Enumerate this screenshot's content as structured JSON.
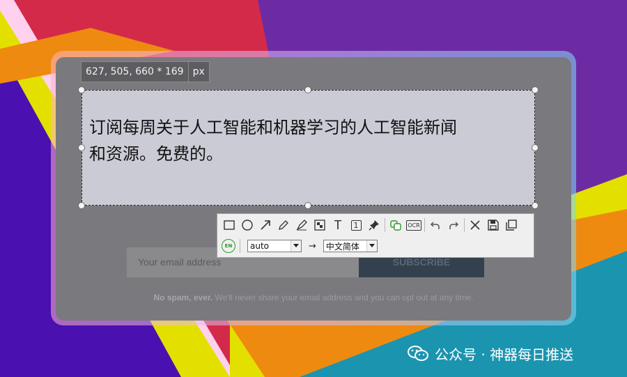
{
  "background": {
    "colors": {
      "red": "#d42a4a",
      "purple": "#6c2ba3",
      "yellow": "#e3e000",
      "orange": "#ee8a10",
      "blue": "#4a10b0",
      "teal": "#1b94b0",
      "pink": "#ffd1ee"
    }
  },
  "page": {
    "email_placeholder": "Your email address",
    "subscribe_label": "SUBSCRIBE",
    "nospam_bold": "No spam, ever.",
    "nospam_text": " We'll never share your email address and you can opt out at any time."
  },
  "capture": {
    "dimensions": "627, 505, 660 * 169",
    "unit": "px",
    "selected_text_line1": "订阅每周关于人工智能和机器学习的人工智能新闻",
    "selected_text_line2": "和资源。免费的。"
  },
  "toolbar": {
    "tools": [
      "rectangle-icon",
      "ellipse-icon",
      "arrow-icon",
      "pen-icon",
      "marker-icon",
      "mosaic-icon",
      "text-icon",
      "number-icon",
      "pin-icon",
      "translate-icon",
      "ocr-icon",
      "undo-icon",
      "redo-icon",
      "close-icon",
      "save-icon",
      "copy-icon"
    ],
    "ocr_label": "OCR",
    "number_label": "1",
    "text_label": "T",
    "lang_badge": "EN",
    "source_lang": "auto",
    "arrow": "→",
    "target_lang": "中文简体"
  },
  "watermark": {
    "text": "公众号 · 神器每日推送"
  }
}
